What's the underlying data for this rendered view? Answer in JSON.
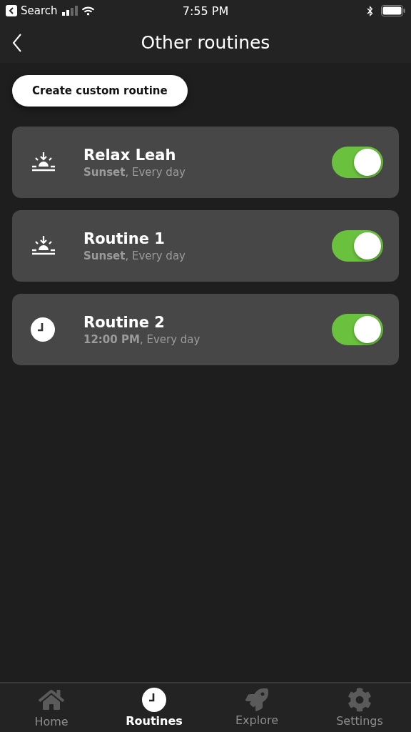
{
  "status_bar": {
    "back_label": "Search",
    "time": "7:55 PM"
  },
  "header": {
    "title": "Other routines"
  },
  "create_button": {
    "label": "Create custom routine"
  },
  "routines": [
    {
      "kind": "sunset",
      "name": "Relax Leah",
      "schedule": "**Sunset**, Every day",
      "on": true
    },
    {
      "kind": "sunset",
      "name": "Routine 1",
      "schedule": "**Sunset**, Every day",
      "on": true
    },
    {
      "kind": "time",
      "name": "Routine 2",
      "schedule": "**12:00 PM**, Every day",
      "on": true
    }
  ],
  "tab_bar": [
    {
      "kind": "home",
      "label": "Home",
      "selected": false
    },
    {
      "kind": "routines",
      "label": "Routines",
      "selected": true
    },
    {
      "kind": "explore",
      "label": "Explore",
      "selected": false
    },
    {
      "kind": "settings",
      "label": "Settings",
      "selected": false
    }
  ]
}
